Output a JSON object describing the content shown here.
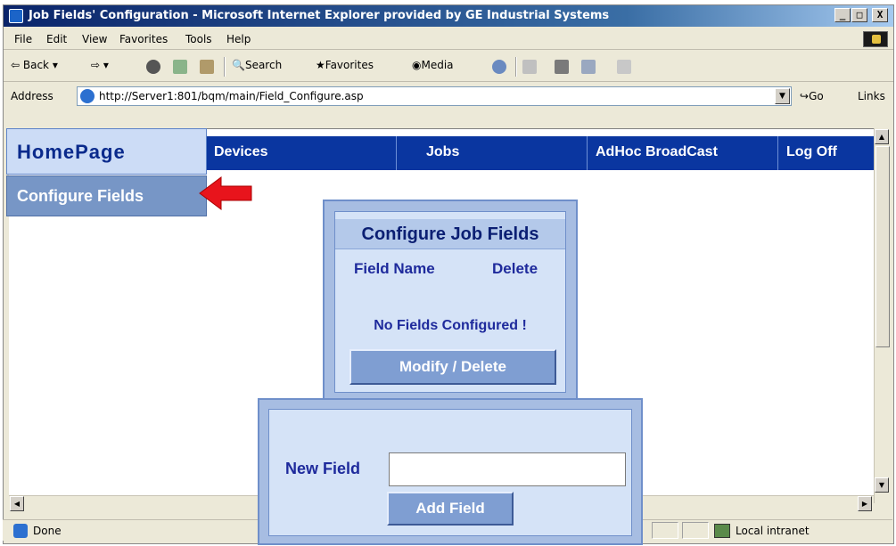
{
  "window": {
    "title": "Job Fields' Configuration - Microsoft Internet Explorer provided by GE Industrial Systems",
    "controls": [
      "_",
      "□",
      "X"
    ]
  },
  "menu": [
    "File",
    "Edit",
    "View",
    "Favorites",
    "Tools",
    "Help"
  ],
  "toolbar": {
    "back": "Back",
    "search": "Search",
    "favorites": "Favorites",
    "media": "Media"
  },
  "address": {
    "label": "Address",
    "url": "http://Server1:801/bqm/main/Field_Configure.asp",
    "go": "Go",
    "links": "Links"
  },
  "nav": {
    "home": "HomePage",
    "items": [
      "Devices",
      "Jobs",
      "AdHoc BroadCast",
      "Log Off"
    ],
    "sub_item": "Configure Fields"
  },
  "config_card": {
    "title": "Configure Job Fields",
    "col_field_name": "Field Name",
    "col_delete": "Delete",
    "empty_message": "No Fields Configured !",
    "modify_button": "Modify / Delete"
  },
  "add_card": {
    "label": "New Field",
    "input_value": "",
    "add_button": "Add Field"
  },
  "status": {
    "text": "Done",
    "zone": "Local intranet"
  }
}
